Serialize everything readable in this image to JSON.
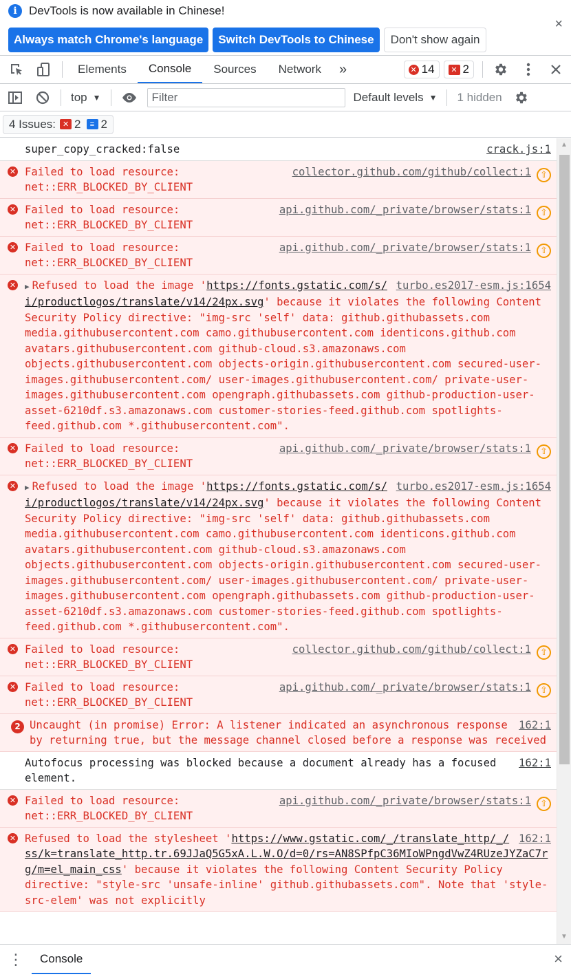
{
  "infobar": {
    "message": "DevTools is now available in Chinese!",
    "btn_match": "Always match Chrome's language",
    "btn_switch": "Switch DevTools to Chinese",
    "btn_dont_show": "Don't show again",
    "close": "×"
  },
  "tabs": {
    "elements": "Elements",
    "console": "Console",
    "sources": "Sources",
    "network": "Network",
    "more": "»",
    "error_count": "14",
    "issue_count": "2"
  },
  "console_toolbar": {
    "context": "top",
    "filter_placeholder": "Filter",
    "levels": "Default levels",
    "hidden": "1 hidden"
  },
  "issues": {
    "label": "4 Issues:",
    "errors": "2",
    "infos": "2"
  },
  "messages": [
    {
      "type": "log",
      "text": "super_copy_cracked:false",
      "source": "crack.js:1"
    },
    {
      "type": "error",
      "text": "Failed to load resource: net::ERR_BLOCKED_BY_CLIENT",
      "source": "collector.github.com/github/collect:1"
    },
    {
      "type": "error",
      "text": "Failed to load resource: net::ERR_BLOCKED_BY_CLIENT",
      "source": "api.github.com/_private/browser/stats:1"
    },
    {
      "type": "error",
      "text": "Failed to load resource: net::ERR_BLOCKED_BY_CLIENT",
      "source": "api.github.com/_private/browser/stats:1"
    },
    {
      "type": "csp",
      "pre": "Refused to load the image '",
      "link": "https://fonts.gstatic.com/s/i/productlogos/translate/v14/24px.svg",
      "post": "' because it violates the following Content Security Policy directive: \"img-src 'self' data: github.githubassets.com media.githubusercontent.com camo.githubusercontent.com identicons.github.com avatars.githubusercontent.com github-cloud.s3.amazonaws.com objects.githubusercontent.com objects-origin.githubusercontent.com secured-user-images.githubusercontent.com/ user-images.githubusercontent.com/ private-user-images.githubusercontent.com opengraph.githubassets.com github-production-user-asset-6210df.s3.amazonaws.com customer-stories-feed.github.com spotlights-feed.github.com *.githubusercontent.com\".",
      "source": "turbo.es2017-esm.js:1654"
    },
    {
      "type": "error",
      "text": "Failed to load resource: net::ERR_BLOCKED_BY_CLIENT",
      "source": "api.github.com/_private/browser/stats:1"
    },
    {
      "type": "csp",
      "pre": "Refused to load the image '",
      "link": "https://fonts.gstatic.com/s/i/productlogos/translate/v14/24px.svg",
      "post": "' because it violates the following Content Security Policy directive: \"img-src 'self' data: github.githubassets.com media.githubusercontent.com camo.githubusercontent.com identicons.github.com avatars.githubusercontent.com github-cloud.s3.amazonaws.com objects.githubusercontent.com objects-origin.githubusercontent.com secured-user-images.githubusercontent.com/ user-images.githubusercontent.com/ private-user-images.githubusercontent.com opengraph.githubassets.com github-production-user-asset-6210df.s3.amazonaws.com customer-stories-feed.github.com spotlights-feed.github.com *.githubusercontent.com\".",
      "source": "turbo.es2017-esm.js:1654"
    },
    {
      "type": "error",
      "text": "Failed to load resource: net::ERR_BLOCKED_BY_CLIENT",
      "source": "collector.github.com/github/collect:1"
    },
    {
      "type": "error",
      "text": "Failed to load resource: net::ERR_BLOCKED_BY_CLIENT",
      "source": "api.github.com/_private/browser/stats:1"
    },
    {
      "type": "uncaught",
      "count": "2",
      "text": "Uncaught (in promise) Error: A listener indicated an asynchronous response by returning true, but the message channel closed before a response was received",
      "source": "162:1"
    },
    {
      "type": "log",
      "text": "Autofocus processing was blocked because a document already has a focused element.",
      "source": "162:1"
    },
    {
      "type": "error",
      "text": "Failed to load resource: net::ERR_BLOCKED_BY_CLIENT",
      "source": "api.github.com/_private/browser/stats:1"
    },
    {
      "type": "csp2",
      "pre": "Refused to load the stylesheet '",
      "link": "https://www.gstatic.com/_/translate_http/_/ss/k=translate_http.tr.69JJaQ5G5xA.L.W.O/d=0/rs=AN8SPfpC36MIoWPngdVwZ4RUzeJYZaC7rg/m=el_main_css",
      "post": "' because it violates the following Content Security Policy directive: \"style-src 'unsafe-inline' github.githubassets.com\". Note that 'style-src-elem' was not explicitly",
      "source": "162:1"
    }
  ],
  "drawer": {
    "tab": "Console",
    "close": "×"
  },
  "colors": {
    "accent": "#1a73e8",
    "error": "#d93025",
    "warning": "#f29900",
    "error_bg": "#fff0f0"
  }
}
